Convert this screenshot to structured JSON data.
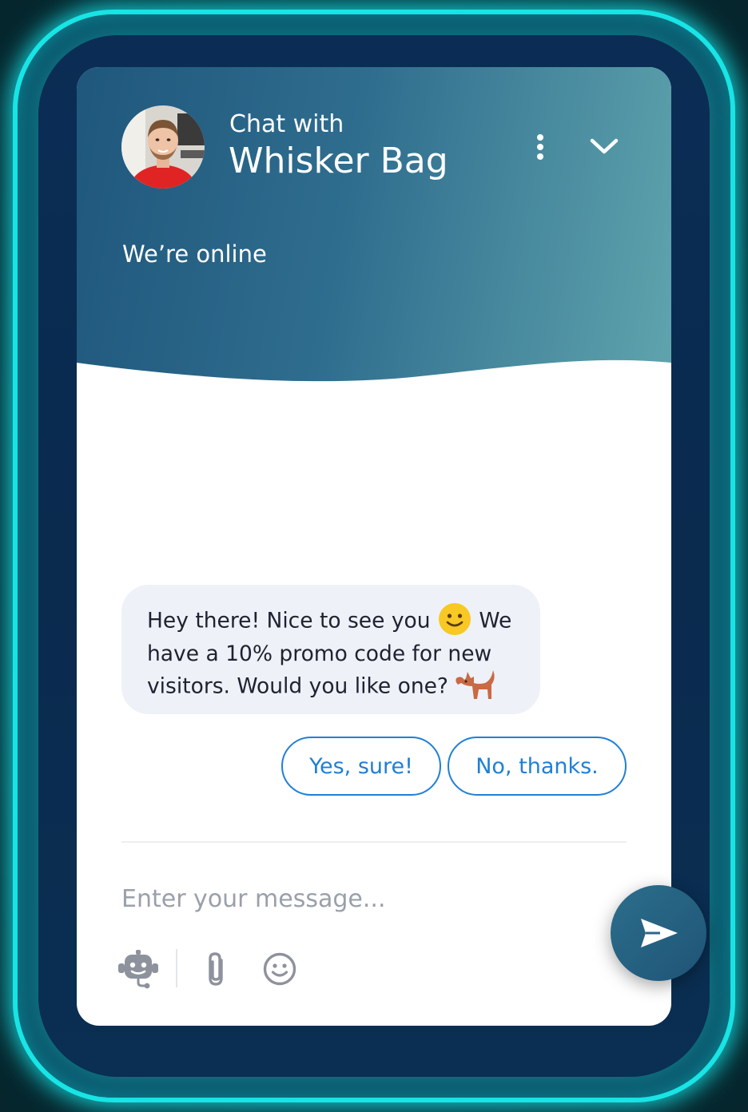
{
  "header": {
    "subtitle": "Chat with",
    "title": "Whisker Bag",
    "status": "We’re online",
    "avatar_icon": "agent-avatar",
    "more_icon": "more-vertical-icon",
    "collapse_icon": "chevron-down-icon"
  },
  "conversation": {
    "bubble_lines": [
      "Hey there! Nice to see you",
      "We",
      "have a 10% promo code for new",
      "visitors. Would you like one?"
    ],
    "emojis": [
      "slightly-smiling-face",
      "dog"
    ]
  },
  "quick_replies": [
    {
      "label": "Yes, sure!"
    },
    {
      "label": "No, thanks."
    }
  ],
  "composer": {
    "placeholder": "Enter your message...",
    "tools": [
      "bot-icon",
      "paperclip-icon",
      "emoji-smile-icon"
    ],
    "send_icon": "send-icon"
  },
  "colors": {
    "header_start": "#1f577c",
    "header_end": "#5fa4ad",
    "accent_blue": "#1f7fd6",
    "bubble_bg": "#eef1f7",
    "glow": "#19e6e6"
  }
}
